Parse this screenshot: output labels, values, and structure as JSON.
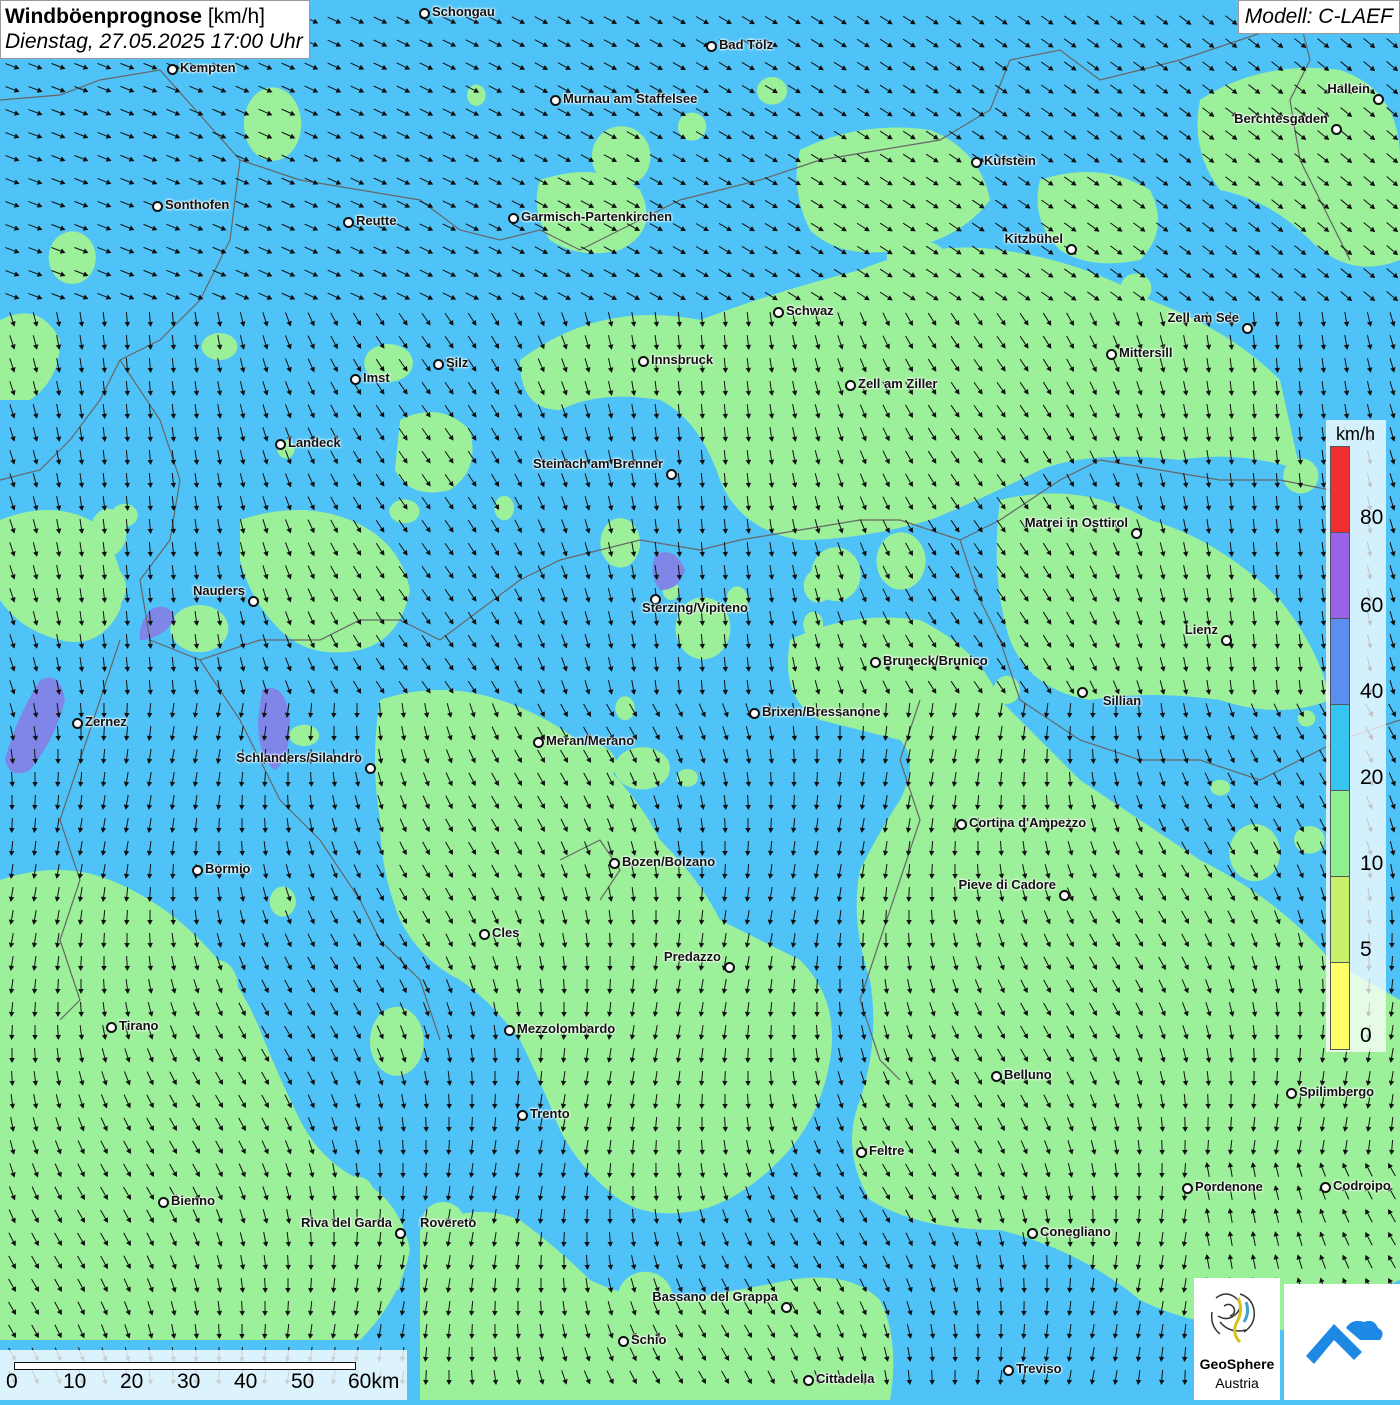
{
  "title": {
    "main": "Windböenprognose",
    "unit": "[km/h]",
    "datetime": "Dienstag, 27.05.2025 17:00 Uhr"
  },
  "model": "Modell: C-LAEF",
  "legend": {
    "unit": "km/h",
    "labels": [
      "80",
      "60",
      "40",
      "20",
      "10",
      "5",
      "0"
    ],
    "colors": [
      "#f03030",
      "#9a62e8",
      "#5a8ef0",
      "#36c4f0",
      "#8ef08e",
      "#c8f06a",
      "#ffff66"
    ]
  },
  "scale_bar": {
    "labels": [
      "0",
      "10",
      "20",
      "30",
      "40",
      "50",
      "60km"
    ]
  },
  "logos": {
    "geosphere_line1": "GeoSphere",
    "geosphere_line2": "Austria"
  },
  "colors": {
    "blue_zone": "#4fc3f7",
    "green_zone": "#9cf09a"
  },
  "cities": [
    {
      "name": "Schongau"
    },
    {
      "name": "Bad Tölz"
    },
    {
      "name": "Kempten"
    },
    {
      "name": "Murnau am Staffelsee"
    },
    {
      "name": "Hallein"
    },
    {
      "name": "Berchtesgaden"
    },
    {
      "name": "Kufstein"
    },
    {
      "name": "Sonthofen"
    },
    {
      "name": "Reutte"
    },
    {
      "name": "Garmisch-Partenkirchen"
    },
    {
      "name": "Kitzbühel"
    },
    {
      "name": "Schwaz"
    },
    {
      "name": "Zell am See"
    },
    {
      "name": "Innsbruck"
    },
    {
      "name": "Mittersill"
    },
    {
      "name": "Imst"
    },
    {
      "name": "Silz"
    },
    {
      "name": "Zell am Ziller"
    },
    {
      "name": "Landeck"
    },
    {
      "name": "Steinach am Brenner"
    },
    {
      "name": "Matrei in Osttirol"
    },
    {
      "name": "Nauders"
    },
    {
      "name": "Sterzing/Vipiteno"
    },
    {
      "name": "Lienz"
    },
    {
      "name": "Bruneck/Brunico"
    },
    {
      "name": "Sillian"
    },
    {
      "name": "Zernez"
    },
    {
      "name": "Brixen/Bressanone"
    },
    {
      "name": "Meran/Merano"
    },
    {
      "name": "Schlanders/Silandro"
    },
    {
      "name": "Cortina d'Ampezzo"
    },
    {
      "name": "Bozen/Bolzano"
    },
    {
      "name": "Bormio"
    },
    {
      "name": "Pieve di Cadore"
    },
    {
      "name": "Cles"
    },
    {
      "name": "Predazzo"
    },
    {
      "name": "Tirano"
    },
    {
      "name": "Mezzolombardo"
    },
    {
      "name": "Belluno"
    },
    {
      "name": "Spilimbergo"
    },
    {
      "name": "Trento"
    },
    {
      "name": "Feltre"
    },
    {
      "name": "Pordenone"
    },
    {
      "name": "Codroipo"
    },
    {
      "name": "Bienno"
    },
    {
      "name": "Riva del Garda"
    },
    {
      "name": "Rovereto"
    },
    {
      "name": "Conegliano"
    },
    {
      "name": "Bassano del Grappa"
    },
    {
      "name": "Schio"
    },
    {
      "name": "Treviso"
    },
    {
      "name": "Cittadella"
    }
  ]
}
